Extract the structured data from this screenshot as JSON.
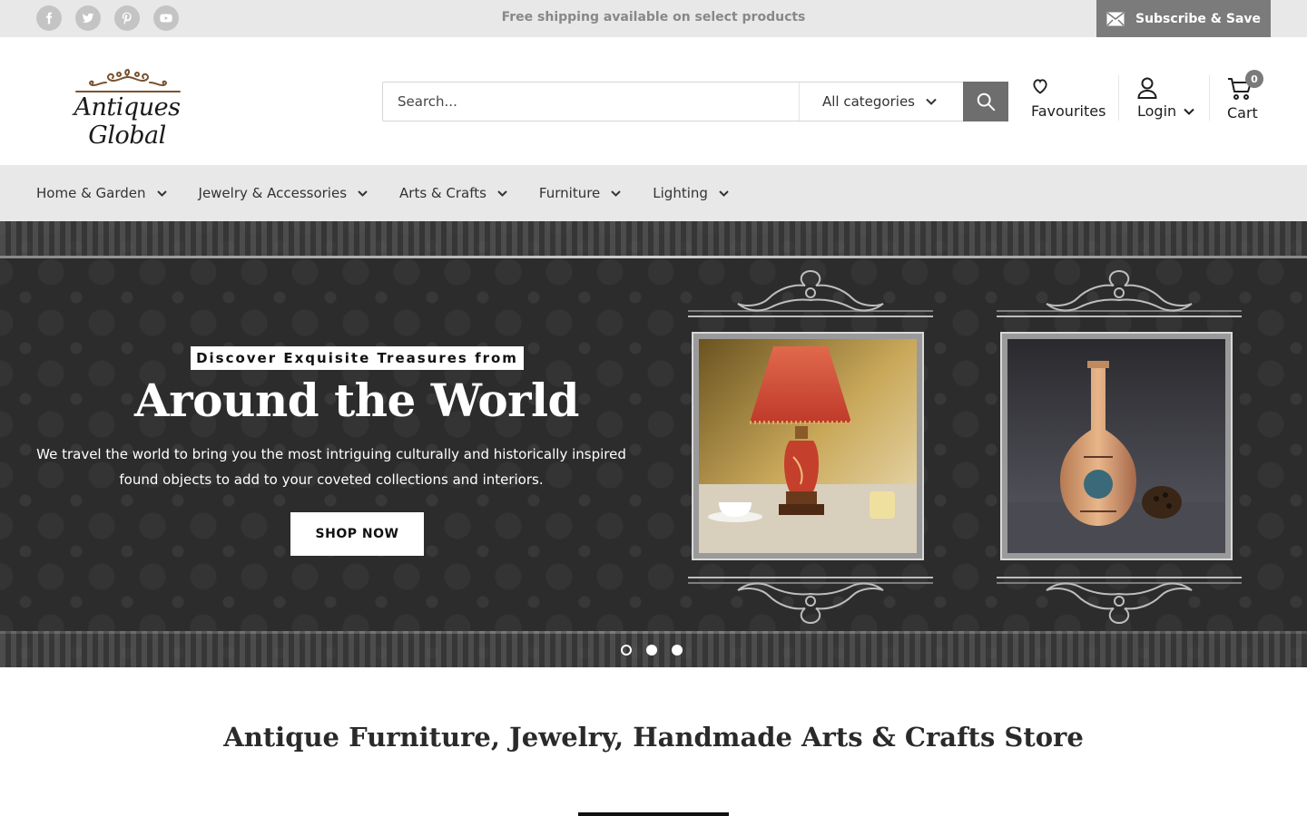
{
  "topbar": {
    "social": [
      {
        "name": "facebook-icon"
      },
      {
        "name": "twitter-icon"
      },
      {
        "name": "pinterest-icon"
      },
      {
        "name": "youtube-icon"
      }
    ],
    "announcement": "Free shipping available on select products",
    "subscribe_label": "Subscribe & Save"
  },
  "header": {
    "logo_text": "Antiques Global",
    "search": {
      "placeholder": "Search...",
      "category_selected": "All categories"
    },
    "favourites_label": "Favourites",
    "login_label": "Login",
    "cart_label": "Cart",
    "cart_count": "0"
  },
  "nav": {
    "items": [
      {
        "label": "Home & Garden"
      },
      {
        "label": "Jewelry & Accessories"
      },
      {
        "label": "Arts & Crafts"
      },
      {
        "label": "Furniture"
      },
      {
        "label": "Lighting"
      }
    ]
  },
  "hero": {
    "tagline": "Discover Exquisite Treasures from",
    "title": "Around the World",
    "text": "We travel the world to bring you the most intriguing culturally and historically inspired found objects to add to your coveted collections and interiors.",
    "cta_label": "SHOP NOW",
    "slides_total": 3,
    "slide_active": 1
  },
  "section": {
    "heading": "Antique Furniture, Jewelry, Handmade Arts & Crafts Store"
  },
  "colors": {
    "topbar_bg": "#e8e8e8",
    "accent_gray": "#7b7b7b",
    "hero_bg": "#2c2c2c"
  }
}
